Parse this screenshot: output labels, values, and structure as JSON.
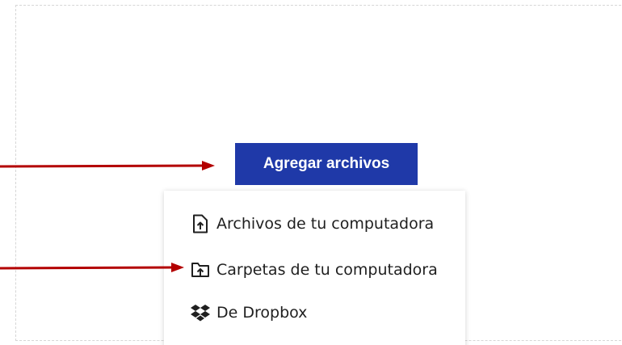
{
  "add_files": {
    "label": "Agregar archivos"
  },
  "menu": {
    "items": [
      {
        "label": "Archivos de tu computadora",
        "icon": "file-upload-icon"
      },
      {
        "label": "Carpetas de tu computadora",
        "icon": "folder-upload-icon"
      },
      {
        "label": "De Dropbox",
        "icon": "dropbox-icon"
      }
    ]
  },
  "colors": {
    "button_bg": "#1f39a8",
    "button_text": "#ffffff",
    "annotation_arrow": "#b30000",
    "menu_text": "#1f1f1f"
  }
}
